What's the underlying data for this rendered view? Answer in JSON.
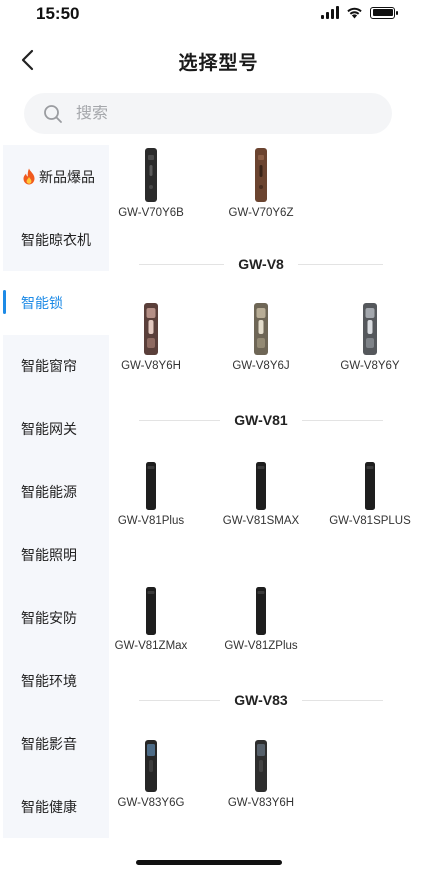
{
  "status_bar": {
    "time": "15:50",
    "battery_level": 1.0
  },
  "nav": {
    "back_icon": "chevron-left-icon",
    "title": "选择型号"
  },
  "search": {
    "icon": "search-icon",
    "placeholder": "搜索"
  },
  "sidebar": {
    "selected_index": 2,
    "accent_color": "#1d8ae6",
    "items": [
      {
        "label": "新品爆品",
        "icon": "fire-icon"
      },
      {
        "label": "智能晾衣机"
      },
      {
        "label": "智能锁"
      },
      {
        "label": "智能窗帘"
      },
      {
        "label": "智能网关"
      },
      {
        "label": "智能能源"
      },
      {
        "label": "智能照明"
      },
      {
        "label": "智能安防"
      },
      {
        "label": "智能环境"
      },
      {
        "label": "智能影音"
      },
      {
        "label": "智能健康"
      }
    ]
  },
  "products": {
    "group_v70": [
      {
        "name": "GW-V70Y6B",
        "finish": "black",
        "color": "#2b2b2b"
      },
      {
        "name": "GW-V70Y6Z",
        "finish": "brown",
        "color": "#6b4430"
      }
    ],
    "sections": [
      {
        "title": "GW-V8",
        "items": [
          {
            "name": "GW-V8Y6H",
            "finish": "rose-bronze",
            "color": "#5a3f3a"
          },
          {
            "name": "GW-V8Y6J",
            "finish": "champagne",
            "color": "#6e6656"
          },
          {
            "name": "GW-V8Y6Y",
            "finish": "silver-grey",
            "color": "#55585c"
          }
        ]
      },
      {
        "title": "GW-V81",
        "items": [
          {
            "name": "GW-V81Plus",
            "finish": "black",
            "color": "#1e1e1e"
          },
          {
            "name": "GW-V81SMAX",
            "finish": "black",
            "color": "#1e1e1e"
          },
          {
            "name": "GW-V81SPLUS",
            "finish": "black",
            "color": "#1e1e1e"
          },
          {
            "name": "GW-V81ZMax",
            "finish": "black",
            "color": "#1e1e1e"
          },
          {
            "name": "GW-V81ZPlus",
            "finish": "black",
            "color": "#1e1e1e"
          }
        ]
      },
      {
        "title": "GW-V83",
        "items": [
          {
            "name": "GW-V83Y6G",
            "finish": "black-screen",
            "color": "#262626"
          },
          {
            "name": "GW-V83Y6H",
            "finish": "black-screen",
            "color": "#2e2e2e"
          }
        ]
      }
    ]
  }
}
